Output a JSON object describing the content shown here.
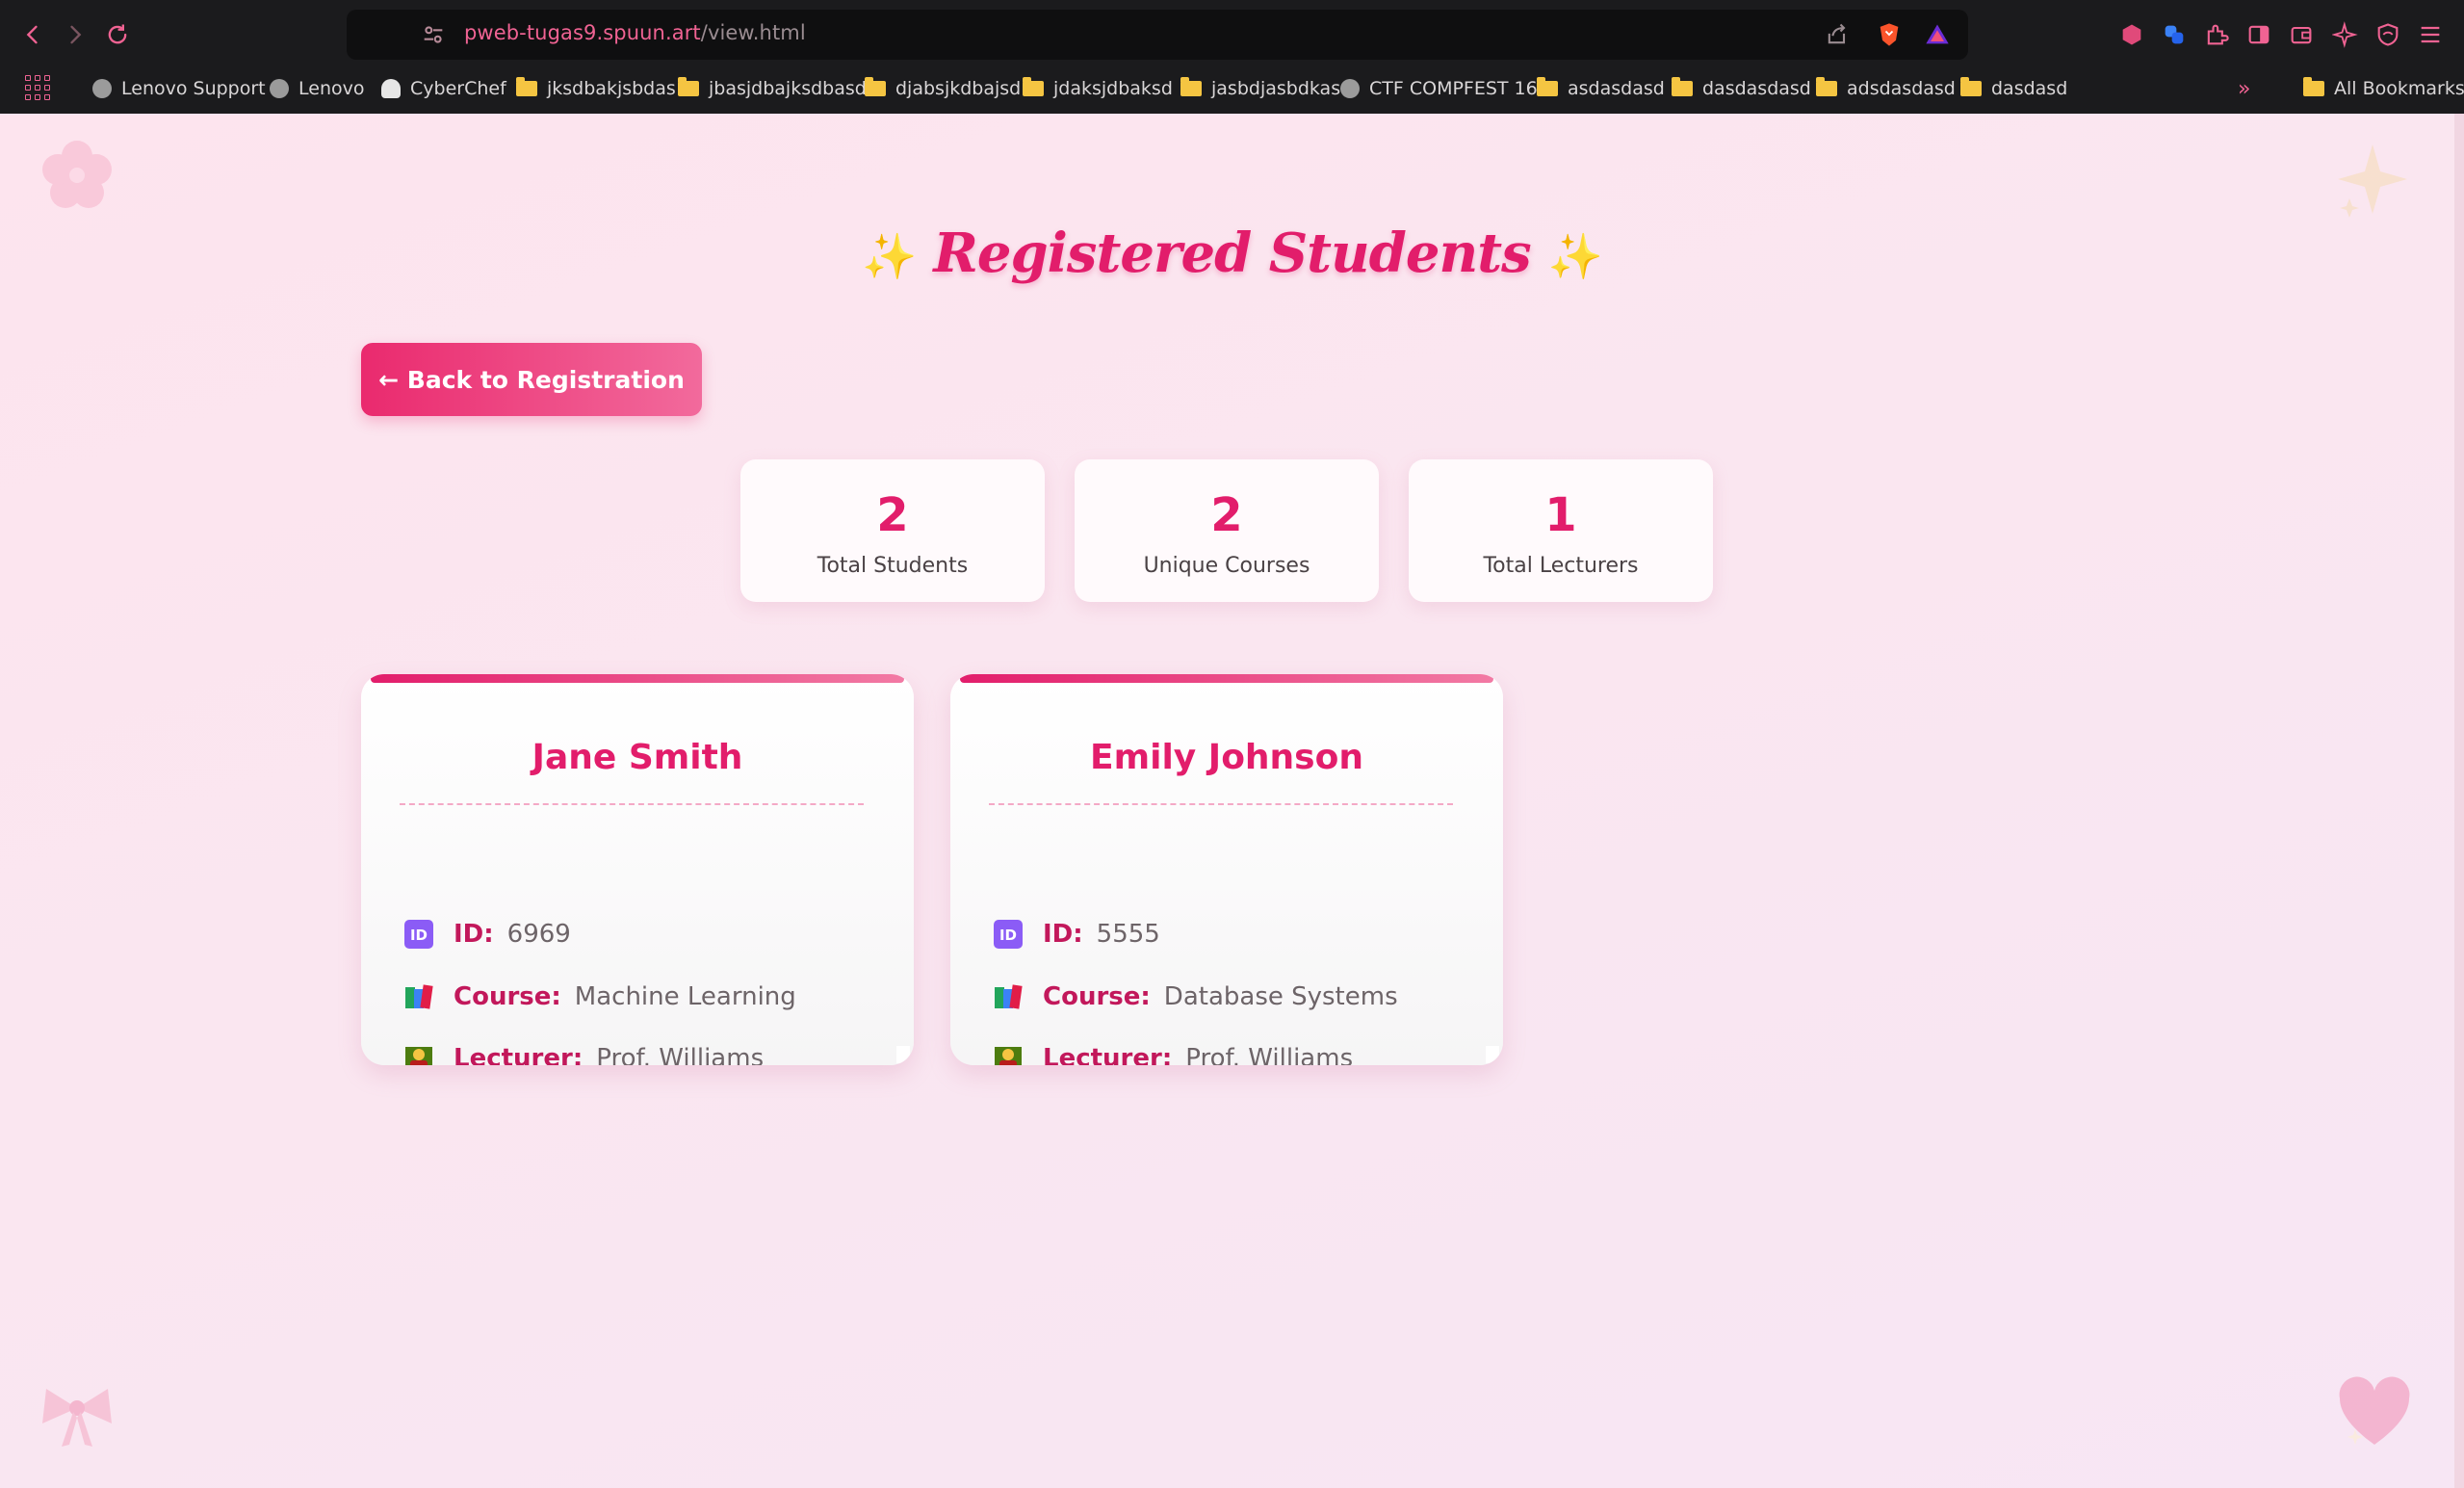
{
  "browser": {
    "url_host": "pweb-tugas9.spuun.art",
    "url_path": "/view.html",
    "bookmarks": [
      {
        "label": "Lenovo Support",
        "icon": "globe-icon"
      },
      {
        "label": "Lenovo",
        "icon": "globe-icon"
      },
      {
        "label": "CyberChef",
        "icon": "chef-icon"
      },
      {
        "label": "jksdbakjsbdas",
        "icon": "folder-icon"
      },
      {
        "label": "jbasjdbajksdbasd",
        "icon": "folder-icon"
      },
      {
        "label": "djabsjkdbajsd",
        "icon": "folder-icon"
      },
      {
        "label": "jdaksjdbaksd",
        "icon": "folder-icon"
      },
      {
        "label": "jasbdjasbdkas",
        "icon": "folder-icon"
      },
      {
        "label": "CTF COMPFEST 16",
        "icon": "globe-icon"
      },
      {
        "label": "asdasdasd",
        "icon": "folder-icon"
      },
      {
        "label": "dasdasdasd",
        "icon": "folder-icon"
      },
      {
        "label": "adsdasdasd",
        "icon": "folder-icon"
      },
      {
        "label": "dasdasd",
        "icon": "folder-icon"
      }
    ],
    "all_bookmarks": "All Bookmarks",
    "overflow": "»",
    "accent": "#f06393"
  },
  "page": {
    "title": "Registered Students",
    "title_sparkle": "✨",
    "back_button": "← Back to Registration",
    "stats": [
      {
        "value": "2",
        "label": "Total Students"
      },
      {
        "value": "2",
        "label": "Unique Courses"
      },
      {
        "value": "1",
        "label": "Total Lecturers"
      }
    ],
    "students": [
      {
        "name": "Jane Smith",
        "id_label": "ID:",
        "id": "6969",
        "course_label": "Course:",
        "course": "Machine Learning",
        "lecturer_label": "Lecturer:",
        "lecturer": "Prof. Williams"
      },
      {
        "name": "Emily Johnson",
        "id_label": "ID:",
        "id": "5555",
        "course_label": "Course:",
        "course": "Database Systems",
        "lecturer_label": "Lecturer:",
        "lecturer": "Prof. Williams"
      }
    ],
    "colors": {
      "primary": "#e21d6b",
      "label": "#c2185b",
      "background": "#fbe4ee"
    }
  }
}
